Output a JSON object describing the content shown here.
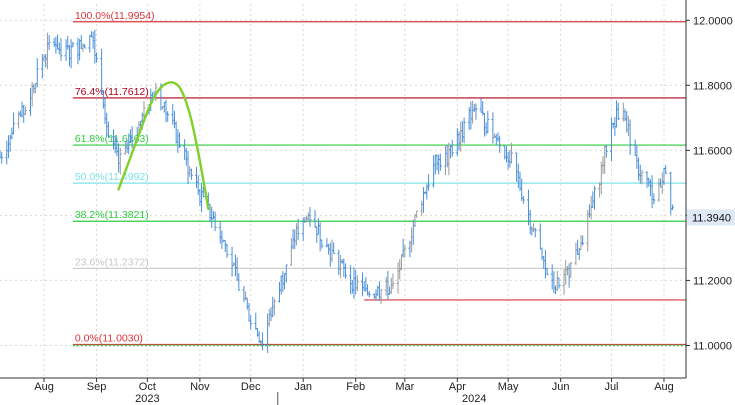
{
  "chart_data": {
    "type": "line",
    "style": "ohlc-bars",
    "grid": true,
    "colors": {
      "bars": "#4a90d9",
      "bars_up": "#9a9a9a",
      "red_line": "#d9363e",
      "dark_red_line": "#b3001b",
      "green_line": "#2ecc40",
      "cyan_line": "#7fe3e8",
      "gray_line": "#c8c8c8",
      "arc": "#7fd12a",
      "last_box": "#dfe9f5"
    },
    "ylim": [
      10.9,
      12.05
    ],
    "y_ticks": [
      "12.0000",
      "11.8000",
      "11.6000",
      "11.4000",
      "11.2000",
      "11.0000"
    ],
    "y_tick_values": [
      12.0,
      11.8,
      11.6,
      11.4,
      11.2,
      11.0
    ],
    "last_value_label": "11.3940",
    "last_value": 11.394,
    "x_months": [
      {
        "label": "Aug",
        "date": "2023-08-15"
      },
      {
        "label": "Sep",
        "date": "2023-09-15"
      },
      {
        "label": "Oct",
        "date": "2023-10-15"
      },
      {
        "label": "Nov",
        "date": "2023-11-15"
      },
      {
        "label": "Dec",
        "date": "2023-12-15"
      },
      {
        "label": "Jan",
        "date": "2024-01-15"
      },
      {
        "label": "Feb",
        "date": "2024-02-15"
      },
      {
        "label": "Mar",
        "date": "2024-03-15"
      },
      {
        "label": "Apr",
        "date": "2024-04-15"
      },
      {
        "label": "May",
        "date": "2024-05-15"
      },
      {
        "label": "Jun",
        "date": "2024-06-15"
      },
      {
        "label": "Jul",
        "date": "2024-07-15"
      },
      {
        "label": "Aug",
        "date": "2024-08-15"
      }
    ],
    "x_years": [
      {
        "label": "2023",
        "date": "2023-10-15"
      },
      {
        "label": "2024",
        "date": "2024-04-25"
      }
    ],
    "x_range": [
      "2023-07-20",
      "2024-08-28"
    ],
    "year_divider": "2023-12-31",
    "fib_levels": [
      {
        "label": "100.0%(11.9954)",
        "value": 11.9954,
        "color": "#d9363e",
        "start": "2023-09-01"
      },
      {
        "label": "76.4%(11.7612)",
        "value": 11.7612,
        "color": "#b3001b",
        "start": "2023-09-01"
      },
      {
        "label": "61.8%(11.6163)",
        "value": 11.6163,
        "color": "#2ecc40",
        "start": "2023-09-01"
      },
      {
        "label": "50.0%(11.4992)",
        "value": 11.4992,
        "color": "#7fe3e8",
        "start": "2023-09-01"
      },
      {
        "label": "38.2%(11.3821)",
        "value": 11.3821,
        "color": "#2ecc40",
        "start": "2023-09-01"
      },
      {
        "label": "23.6%(11.2372)",
        "value": 11.2372,
        "color": "#c8c8c8",
        "start": "2023-09-01"
      },
      {
        "label": "0.0%(11.0030)",
        "value": 11.003,
        "color": "#d9363e",
        "start": "2023-09-01"
      }
    ],
    "support_line": {
      "value": 11.14,
      "start": "2024-02-20",
      "color": "#d9363e"
    },
    "dotted_level": {
      "value": 11.0,
      "color": "#2ecc40"
    },
    "arc_points": [
      {
        "date": "2023-09-28",
        "value": 11.48
      },
      {
        "date": "2023-10-08",
        "value": 11.62
      },
      {
        "date": "2023-10-20",
        "value": 11.79
      },
      {
        "date": "2023-11-01",
        "value": 11.82
      },
      {
        "date": "2023-11-08",
        "value": 11.74
      },
      {
        "date": "2023-11-14",
        "value": 11.6
      },
      {
        "date": "2023-11-20",
        "value": 11.42
      }
    ],
    "price_path": [
      [
        "2023-07-20",
        11.58
      ],
      [
        "2023-07-28",
        11.66
      ],
      [
        "2023-08-05",
        11.74
      ],
      [
        "2023-08-12",
        11.86
      ],
      [
        "2023-08-20",
        11.94
      ],
      [
        "2023-08-27",
        11.9
      ],
      [
        "2023-09-05",
        11.92
      ],
      [
        "2023-09-12",
        11.95
      ],
      [
        "2023-09-18",
        11.8
      ],
      [
        "2023-09-22",
        11.64
      ],
      [
        "2023-09-28",
        11.56
      ],
      [
        "2023-10-05",
        11.62
      ],
      [
        "2023-10-12",
        11.7
      ],
      [
        "2023-10-20",
        11.78
      ],
      [
        "2023-10-28",
        11.7
      ],
      [
        "2023-11-03",
        11.62
      ],
      [
        "2023-11-10",
        11.52
      ],
      [
        "2023-11-17",
        11.44
      ],
      [
        "2023-11-24",
        11.38
      ],
      [
        "2023-12-01",
        11.3
      ],
      [
        "2023-12-08",
        11.18
      ],
      [
        "2023-12-15",
        11.08
      ],
      [
        "2023-12-22",
        11.01
      ],
      [
        "2023-12-29",
        11.14
      ],
      [
        "2024-01-06",
        11.26
      ],
      [
        "2024-01-12",
        11.36
      ],
      [
        "2024-01-19",
        11.4
      ],
      [
        "2024-01-27",
        11.32
      ],
      [
        "2024-02-04",
        11.26
      ],
      [
        "2024-02-12",
        11.2
      ],
      [
        "2024-02-20",
        11.16
      ],
      [
        "2024-03-01",
        11.17
      ],
      [
        "2024-03-08",
        11.18
      ],
      [
        "2024-03-16",
        11.3
      ],
      [
        "2024-03-24",
        11.44
      ],
      [
        "2024-04-02",
        11.56
      ],
      [
        "2024-04-10",
        11.58
      ],
      [
        "2024-04-18",
        11.66
      ],
      [
        "2024-04-25",
        11.74
      ],
      [
        "2024-05-02",
        11.68
      ],
      [
        "2024-05-10",
        11.62
      ],
      [
        "2024-05-18",
        11.56
      ],
      [
        "2024-05-26",
        11.42
      ],
      [
        "2024-06-03",
        11.28
      ],
      [
        "2024-06-10",
        11.18
      ],
      [
        "2024-06-17",
        11.2
      ],
      [
        "2024-06-24",
        11.28
      ],
      [
        "2024-07-01",
        11.38
      ],
      [
        "2024-07-08",
        11.52
      ],
      [
        "2024-07-15",
        11.68
      ],
      [
        "2024-07-22",
        11.74
      ],
      [
        "2024-07-29",
        11.56
      ],
      [
        "2024-08-05",
        11.5
      ],
      [
        "2024-08-10",
        11.44
      ],
      [
        "2024-08-15",
        11.54
      ],
      [
        "2024-08-20",
        11.4
      ]
    ]
  }
}
